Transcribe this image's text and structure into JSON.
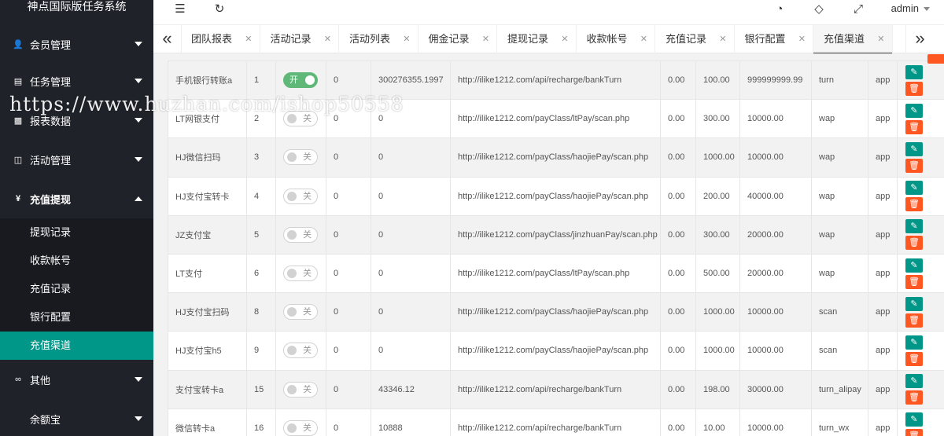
{
  "brand": "神点国际版任务系统",
  "header": {
    "user": "admin",
    "icons": {
      "menu_toggle": "☰",
      "refresh": "↻",
      "theme": "◔",
      "tag": "◇",
      "fullscreen": "⤢"
    }
  },
  "sidebar": {
    "items": [
      {
        "label": "会员管理",
        "icon": "user-icon"
      },
      {
        "label": "任务管理",
        "icon": "document-icon"
      },
      {
        "label": "报表数据",
        "icon": "chart-icon"
      },
      {
        "label": "活动管理",
        "icon": "book-icon"
      },
      {
        "label": "充值提现",
        "icon": "yen-icon"
      },
      {
        "label": "其他",
        "icon": "infinity-icon"
      },
      {
        "label": "余额宝",
        "icon": ""
      }
    ],
    "submenu": [
      "提现记录",
      "收款帐号",
      "充值记录",
      "银行配置",
      "充值渠道"
    ]
  },
  "tabs": [
    "团队报表",
    "活动记录",
    "活动列表",
    "佣金记录",
    "提现记录",
    "收款帐号",
    "充值记录",
    "银行配置",
    "充值渠道"
  ],
  "switch_labels": {
    "on": "开",
    "off": "关"
  },
  "rows": [
    {
      "name": "手机银行转账a",
      "id": "1",
      "status": "on",
      "c3": "0",
      "c4": "300276355.1997",
      "url": "http://ilike1212.com/api/recharge/bankTurn",
      "fee": "0.00",
      "min": "100.00",
      "max": "999999999.99",
      "mode": "turn",
      "client": "app"
    },
    {
      "name": "LT网银支付",
      "id": "2",
      "status": "off",
      "c3": "0",
      "c4": "0",
      "url": "http://ilike1212.com/payClass/ltPay/scan.php",
      "fee": "0.00",
      "min": "300.00",
      "max": "10000.00",
      "mode": "wap",
      "client": "app"
    },
    {
      "name": "HJ微信扫玛",
      "id": "3",
      "status": "off",
      "c3": "0",
      "c4": "0",
      "url": "http://ilike1212.com/payClass/haojiePay/scan.php",
      "fee": "0.00",
      "min": "1000.00",
      "max": "10000.00",
      "mode": "wap",
      "client": "app"
    },
    {
      "name": "HJ支付宝转卡",
      "id": "4",
      "status": "off",
      "c3": "0",
      "c4": "0",
      "url": "http://ilike1212.com/payClass/haojiePay/scan.php",
      "fee": "0.00",
      "min": "200.00",
      "max": "40000.00",
      "mode": "wap",
      "client": "app"
    },
    {
      "name": "JZ支付宝",
      "id": "5",
      "status": "off",
      "c3": "0",
      "c4": "0",
      "url": "http://ilike1212.com/payClass/jinzhuanPay/scan.php",
      "fee": "0.00",
      "min": "300.00",
      "max": "20000.00",
      "mode": "wap",
      "client": "app"
    },
    {
      "name": "LT支付",
      "id": "6",
      "status": "off",
      "c3": "0",
      "c4": "0",
      "url": "http://ilike1212.com/payClass/ltPay/scan.php",
      "fee": "0.00",
      "min": "500.00",
      "max": "20000.00",
      "mode": "wap",
      "client": "app"
    },
    {
      "name": "HJ支付宝扫码",
      "id": "8",
      "status": "off",
      "c3": "0",
      "c4": "0",
      "url": "http://ilike1212.com/payClass/haojiePay/scan.php",
      "fee": "0.00",
      "min": "1000.00",
      "max": "10000.00",
      "mode": "scan",
      "client": "app"
    },
    {
      "name": "HJ支付宝h5",
      "id": "9",
      "status": "off",
      "c3": "0",
      "c4": "0",
      "url": "http://ilike1212.com/payClass/haojiePay/scan.php",
      "fee": "0.00",
      "min": "1000.00",
      "max": "10000.00",
      "mode": "scan",
      "client": "app"
    },
    {
      "name": "支付宝转卡a",
      "id": "15",
      "status": "off",
      "c3": "0",
      "c4": "43346.12",
      "url": "http://ilike1212.com/api/recharge/bankTurn",
      "fee": "0.00",
      "min": "198.00",
      "max": "30000.00",
      "mode": "turn_alipay",
      "client": "app"
    },
    {
      "name": "微信转卡a",
      "id": "16",
      "status": "off",
      "c3": "0",
      "c4": "10888",
      "url": "http://ilike1212.com/api/recharge/bankTurn",
      "fee": "0.00",
      "min": "10.00",
      "max": "10000.00",
      "mode": "turn_wx",
      "client": "app"
    }
  ],
  "action_icons": {
    "edit": "✎",
    "delete": "🗑"
  },
  "watermark": "https://www.huzhan.com/ishop50558",
  "colors": {
    "sidebar_bg": "#20222a",
    "accent": "#009688",
    "switch_on": "#5fb878",
    "danger": "#ff5722"
  }
}
